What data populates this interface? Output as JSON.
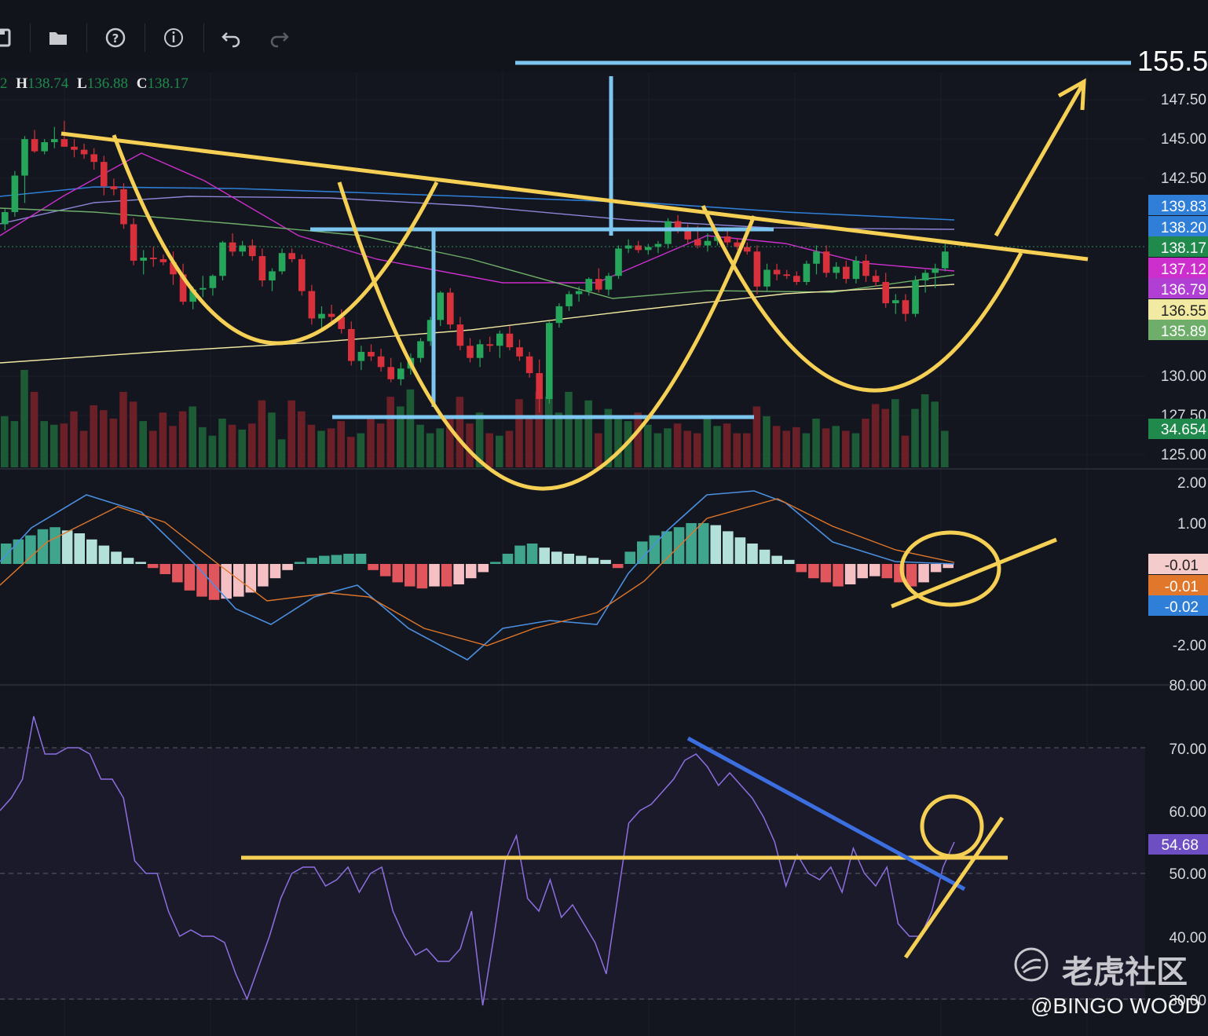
{
  "toolbar": {
    "buttons": [
      {
        "name": "save-icon",
        "label": "save"
      },
      {
        "name": "folder-icon",
        "label": "open"
      },
      {
        "name": "help-icon",
        "label": "help"
      },
      {
        "name": "info-icon",
        "label": "info"
      },
      {
        "name": "undo-icon",
        "label": "undo"
      },
      {
        "name": "redo-icon",
        "label": "redo"
      }
    ]
  },
  "ohlc": {
    "o_fragment": "2",
    "h_label": "H",
    "h_value": "138.74",
    "l_label": "L",
    "l_value": "136.88",
    "c_label": "C",
    "c_value": "138.17"
  },
  "target_price": "155.5",
  "watermark": {
    "brand": "老虎社区",
    "handle": "@BINGO WOOD"
  },
  "chart_data": [
    {
      "type": "candlestick",
      "panel": "price",
      "ylim": [
        124,
        150
      ],
      "y_ticks": [
        "147.50",
        "145.00",
        "142.50",
        "130.00",
        "127.50",
        "125.00"
      ],
      "price_tags": [
        {
          "label": "139.83",
          "color": "#2f7fd8"
        },
        {
          "label": "138.20",
          "color": "#2f7fd8"
        },
        {
          "label": "138.17",
          "color": "#1f8a4c"
        },
        {
          "label": "137.12",
          "color": "#cc2fcc"
        },
        {
          "label": "136.79",
          "color": "#b13fd3"
        },
        {
          "label": "136.55",
          "color": "#f2eaa2"
        },
        {
          "label": "135.89",
          "color": "#6fae6a"
        }
      ],
      "volume_tag": {
        "label": "34.654",
        "color": "#1f8a4c"
      },
      "candles": [
        [
          140.0,
          141.0,
          139.6,
          140.8
        ],
        [
          140.8,
          143.5,
          140.5,
          143.2
        ],
        [
          143.2,
          145.8,
          141.4,
          145.6
        ],
        [
          145.6,
          146.2,
          144.7,
          144.8
        ],
        [
          144.8,
          145.6,
          144.6,
          145.4
        ],
        [
          145.4,
          146.4,
          145.0,
          145.6
        ],
        [
          145.6,
          146.8,
          145.2,
          145.1
        ],
        [
          145.1,
          145.6,
          144.4,
          144.9
        ],
        [
          144.9,
          145.3,
          144.3,
          144.6
        ],
        [
          144.6,
          145.0,
          143.6,
          144.1
        ],
        [
          144.1,
          144.5,
          141.9,
          142.5
        ],
        [
          142.5,
          143.0,
          141.9,
          142.3
        ],
        [
          142.3,
          142.7,
          139.7,
          140.0
        ],
        [
          140.0,
          140.4,
          137.3,
          137.6
        ],
        [
          137.6,
          138.3,
          136.7,
          137.8
        ],
        [
          137.8,
          138.5,
          137.2,
          137.7
        ],
        [
          137.7,
          138.0,
          137.3,
          137.5
        ],
        [
          137.5,
          138.2,
          136.0,
          136.7
        ],
        [
          136.7,
          137.4,
          134.7,
          134.9
        ],
        [
          134.9,
          135.9,
          134.4,
          135.7
        ],
        [
          135.7,
          136.6,
          135.2,
          135.8
        ],
        [
          135.8,
          136.7,
          135.3,
          136.6
        ],
        [
          136.6,
          138.9,
          136.3,
          138.8
        ],
        [
          138.8,
          139.4,
          137.9,
          138.2
        ],
        [
          138.2,
          138.9,
          137.9,
          138.6
        ],
        [
          138.6,
          139.0,
          137.6,
          137.9
        ],
        [
          137.9,
          138.4,
          135.9,
          136.3
        ],
        [
          136.3,
          137.1,
          135.6,
          136.9
        ],
        [
          136.9,
          138.4,
          136.7,
          138.1
        ],
        [
          138.1,
          138.4,
          137.5,
          137.7
        ],
        [
          137.7,
          138.0,
          135.3,
          135.6
        ],
        [
          135.6,
          136.0,
          133.4,
          133.8
        ],
        [
          133.8,
          134.6,
          133.1,
          134.1
        ],
        [
          134.1,
          134.7,
          133.3,
          133.9
        ],
        [
          133.9,
          134.4,
          132.8,
          133.1
        ],
        [
          133.1,
          133.6,
          130.7,
          131.0
        ],
        [
          131.0,
          132.0,
          130.4,
          131.6
        ],
        [
          131.6,
          132.1,
          131.0,
          131.3
        ],
        [
          131.3,
          131.8,
          130.3,
          130.6
        ],
        [
          130.6,
          131.2,
          129.6,
          129.8
        ],
        [
          129.8,
          130.9,
          129.4,
          130.5
        ],
        [
          130.5,
          131.5,
          130.1,
          131.2
        ],
        [
          131.2,
          132.5,
          130.9,
          132.3
        ],
        [
          132.3,
          133.9,
          132.0,
          133.7
        ],
        [
          133.7,
          135.6,
          133.3,
          135.5
        ],
        [
          135.5,
          135.8,
          133.1,
          133.4
        ],
        [
          133.4,
          133.9,
          131.7,
          132.0
        ],
        [
          132.0,
          132.5,
          130.9,
          131.2
        ],
        [
          131.2,
          132.4,
          130.6,
          132.1
        ],
        [
          132.1,
          132.6,
          131.6,
          132.0
        ],
        [
          132.0,
          133.0,
          131.2,
          132.8
        ],
        [
          132.8,
          133.3,
          131.7,
          131.9
        ],
        [
          131.9,
          132.4,
          131.0,
          131.3
        ],
        [
          131.3,
          131.6,
          129.9,
          130.2
        ],
        [
          130.2,
          131.1,
          127.6,
          128.5
        ],
        [
          128.5,
          133.6,
          128.2,
          133.5
        ],
        [
          133.5,
          134.8,
          133.2,
          134.6
        ],
        [
          134.6,
          135.6,
          134.3,
          135.4
        ],
        [
          135.4,
          135.9,
          134.9,
          135.6
        ],
        [
          135.6,
          136.5,
          135.3,
          136.4
        ],
        [
          136.4,
          137.1,
          135.5,
          135.7
        ],
        [
          135.7,
          136.8,
          135.3,
          136.6
        ],
        [
          136.6,
          138.6,
          136.4,
          138.4
        ],
        [
          138.4,
          139.0,
          138.1,
          138.6
        ],
        [
          138.6,
          138.9,
          138.1,
          138.3
        ],
        [
          138.3,
          138.7,
          138.0,
          138.5
        ],
        [
          138.5,
          138.9,
          138.1,
          138.7
        ],
        [
          138.7,
          140.4,
          138.4,
          140.2
        ],
        [
          140.2,
          140.6,
          139.4,
          139.7
        ],
        [
          139.7,
          140.0,
          138.7,
          139.0
        ],
        [
          139.0,
          139.9,
          138.4,
          138.6
        ],
        [
          138.6,
          139.4,
          138.2,
          138.9
        ],
        [
          138.9,
          139.5,
          138.6,
          139.2
        ],
        [
          139.2,
          139.7,
          138.6,
          138.8
        ],
        [
          138.8,
          139.1,
          138.3,
          138.5
        ],
        [
          138.5,
          138.8,
          138.0,
          138.2
        ],
        [
          138.2,
          138.6,
          135.4,
          135.9
        ],
        [
          135.9,
          137.4,
          135.6,
          137.0
        ],
        [
          137.0,
          137.4,
          136.3,
          136.7
        ],
        [
          136.7,
          137.0,
          136.4,
          136.6
        ],
        [
          136.6,
          136.9,
          136.0,
          136.2
        ],
        [
          136.2,
          137.6,
          136.0,
          137.4
        ],
        [
          137.4,
          138.6,
          136.7,
          138.2
        ],
        [
          138.2,
          138.6,
          136.5,
          136.8
        ],
        [
          136.8,
          137.5,
          136.4,
          137.2
        ],
        [
          137.2,
          137.6,
          136.1,
          136.4
        ],
        [
          136.4,
          137.9,
          136.1,
          137.6
        ],
        [
          137.6,
          138.0,
          136.2,
          136.6
        ],
        [
          136.6,
          137.0,
          135.9,
          136.2
        ],
        [
          136.2,
          136.8,
          134.5,
          134.8
        ],
        [
          134.8,
          135.4,
          134.1,
          135.0
        ],
        [
          135.0,
          135.4,
          133.6,
          134.1
        ],
        [
          134.1,
          136.6,
          133.9,
          136.3
        ],
        [
          136.3,
          137.0,
          135.5,
          136.8
        ],
        [
          136.8,
          137.4,
          135.8,
          137.1
        ],
        [
          137.1,
          138.7,
          136.9,
          138.2
        ]
      ],
      "volumes": [
        42,
        38,
        80,
        62,
        38,
        35,
        36,
        46,
        30,
        51,
        47,
        40,
        62,
        54,
        38,
        30,
        45,
        34,
        46,
        50,
        33,
        26,
        40,
        35,
        31,
        36,
        55,
        45,
        23,
        55,
        46,
        35,
        30,
        32,
        38,
        25,
        28,
        40,
        36,
        58,
        50,
        64,
        35,
        28,
        32,
        40,
        58,
        36,
        45,
        28,
        26,
        30,
        56,
        42,
        62,
        58,
        45,
        62,
        40,
        55,
        28,
        48,
        40,
        38,
        45,
        35,
        28,
        32,
        36,
        30,
        28,
        40,
        34,
        36,
        28,
        28,
        50,
        42,
        34,
        30,
        33,
        28,
        40,
        32,
        34,
        30,
        28,
        40,
        52,
        48,
        56,
        26,
        48,
        60,
        54,
        30
      ],
      "moving_averages": [
        {
          "color": "#2f7fd8",
          "label": "139.83"
        },
        {
          "color": "#8c86d8",
          "label": "138.20"
        },
        {
          "color": "#cc2fcc",
          "label": "137.12"
        },
        {
          "color": "#b13fd3",
          "label": "136.79"
        },
        {
          "color": "#f2eaa2",
          "label": "136.55"
        },
        {
          "color": "#6fae6a",
          "label": "135.89"
        }
      ],
      "annotations": [
        "cup-and-handle arcs",
        "neckline trendline",
        "measured-move target 155.5",
        "upward arrow"
      ]
    },
    {
      "type": "macd",
      "panel": "macd",
      "ylim": [
        -2.5,
        2.2
      ],
      "y_ticks": [
        "2.00",
        "1.00",
        "-2.00"
      ],
      "tags": [
        {
          "label": "-0.01",
          "color": "#f5cccc",
          "text_color": "#222222"
        },
        {
          "label": "-0.01",
          "color": "#e0772a",
          "text_color": "#ffffff"
        },
        {
          "label": "-0.02",
          "color": "#2f7fd8",
          "text_color": "#ffffff"
        }
      ],
      "histogram": [
        0.5,
        0.6,
        0.7,
        0.85,
        0.9,
        0.82,
        0.75,
        0.6,
        0.45,
        0.3,
        0.15,
        0.05,
        -0.1,
        -0.25,
        -0.45,
        -0.65,
        -0.8,
        -0.88,
        -0.85,
        -0.8,
        -0.7,
        -0.55,
        -0.35,
        -0.15,
        0.05,
        0.15,
        0.2,
        0.22,
        0.25,
        0.25,
        -0.15,
        -0.3,
        -0.45,
        -0.55,
        -0.6,
        -0.55,
        -0.55,
        -0.5,
        -0.35,
        -0.2,
        0.05,
        0.25,
        0.45,
        0.5,
        0.4,
        0.3,
        0.25,
        0.2,
        0.15,
        0.1,
        -0.1,
        0.3,
        0.55,
        0.7,
        0.8,
        0.9,
        1.0,
        1.0,
        0.95,
        0.8,
        0.65,
        0.5,
        0.35,
        0.2,
        0.1,
        -0.2,
        -0.35,
        -0.45,
        -0.55,
        -0.5,
        -0.35,
        -0.3,
        -0.35,
        -0.45,
        -0.55,
        -0.45,
        -0.2,
        -0.1
      ]
    },
    {
      "type": "line",
      "panel": "rsi",
      "ylim": [
        26,
        82
      ],
      "y_ticks": [
        "80.00",
        "70.00",
        "60.00",
        "50.00",
        "40.00",
        "30.00"
      ],
      "levels": [
        70,
        50,
        30
      ],
      "last_value_tag": {
        "label": "54.68",
        "color": "#6d4fc3"
      },
      "values": [
        60,
        62,
        65,
        75,
        69,
        69,
        70,
        70,
        69,
        65,
        65,
        62,
        52,
        50,
        50,
        44,
        40,
        41,
        40,
        40,
        39,
        34,
        30,
        35,
        40,
        46,
        50,
        51,
        51,
        48,
        49,
        51,
        47,
        50,
        51,
        44,
        40,
        37,
        38,
        36,
        36,
        38,
        44,
        29,
        40,
        52,
        56,
        46,
        44,
        49,
        43,
        45,
        42,
        39,
        34,
        46,
        58,
        60,
        61,
        63,
        65,
        68,
        69,
        67,
        64,
        66,
        64,
        62,
        59,
        55,
        48,
        53,
        50,
        49,
        51,
        47,
        54,
        50,
        48,
        51,
        42,
        40,
        40,
        44,
        51,
        55
      ]
    }
  ]
}
